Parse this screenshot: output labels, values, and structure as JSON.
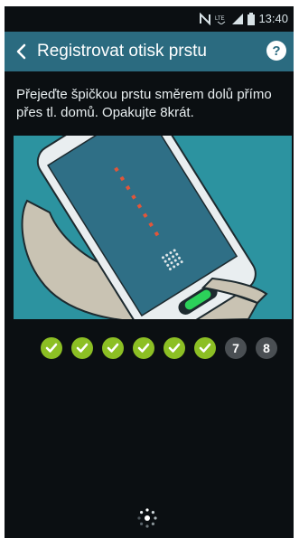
{
  "statusbar": {
    "time": "13:40",
    "lte": "LTE",
    "icons": [
      "nfc-icon",
      "lte-icon",
      "signal-icon",
      "battery-icon"
    ]
  },
  "appbar": {
    "title": "Registrovat otisk prstu",
    "back_icon": "chevron-left-icon",
    "help_label": "?"
  },
  "instruction": "Přejeďte špičkou prstu směrem dolů přímo přes tl. domů. Opakujte 8krát.",
  "progress": {
    "completed": 6,
    "total": 8,
    "remaining_labels": [
      "7",
      "8"
    ]
  },
  "colors": {
    "appbar": "#2b6b80",
    "illustration_bg": "#2c93a0",
    "done": "#8cbf24",
    "todo": "#4a4f53",
    "home_indicator": "#2cd15a"
  }
}
